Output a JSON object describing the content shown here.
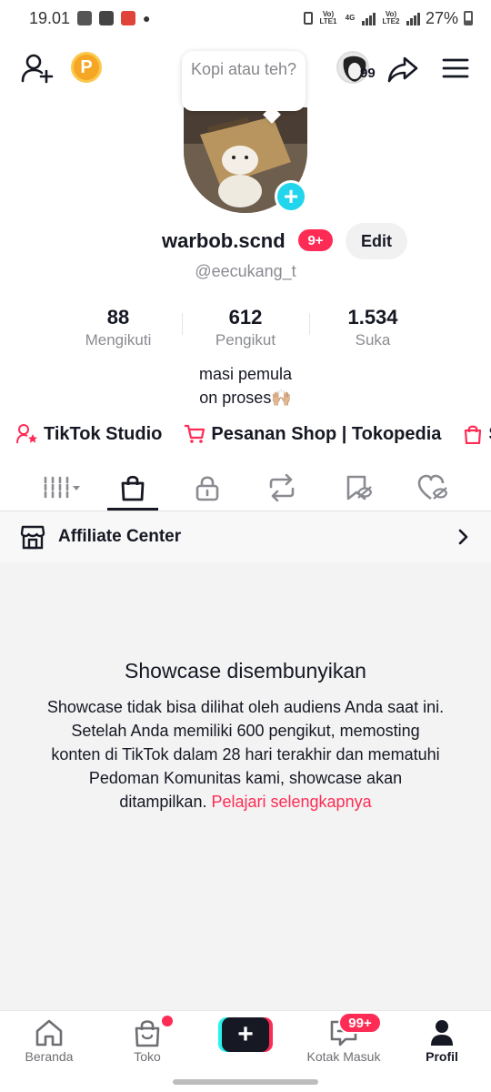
{
  "status_bar": {
    "time": "19.01",
    "network_1": "Vo) LTE1",
    "network_2": "4G",
    "network_3": "Vo) LTE2",
    "battery": "27%"
  },
  "top_nav": {
    "coin_letter": "P",
    "story_count": "99",
    "tooltip": "Kopi atau teh?"
  },
  "profile": {
    "display_name": "warbob.scnd",
    "notification_badge": "9+",
    "edit_label": "Edit",
    "username": "@eecukang_t",
    "stats": [
      {
        "value": "88",
        "label": "Mengikuti"
      },
      {
        "value": "612",
        "label": "Pengikut"
      },
      {
        "value": "1.534",
        "label": "Suka"
      }
    ],
    "bio_line_1": "masi pemula",
    "bio_line_2": "on proses🙌🏼"
  },
  "shortcuts": [
    {
      "label": "TikTok Studio"
    },
    {
      "label": "Pesanan Shop | Tokopedia"
    },
    {
      "label": "Sl"
    }
  ],
  "affiliate": {
    "label": "Affiliate Center"
  },
  "showcase": {
    "title": "Showcase disembunyikan",
    "description": "Showcase tidak bisa dilihat oleh audiens Anda saat ini. Setelah Anda memiliki 600 pengikut, memosting konten di TikTok dalam 28 hari terakhir dan mematuhi Pedoman Komunitas kami, showcase akan ditampilkan.",
    "link": "Pelajari selengkapnya"
  },
  "bottom_nav": {
    "items": [
      {
        "label": "Beranda"
      },
      {
        "label": "Toko"
      },
      {
        "label": "Kotak Masuk"
      },
      {
        "label": "Profil"
      }
    ],
    "inbox_badge": "99+"
  },
  "colors": {
    "accent": "#fe2c55",
    "cyan": "#25f4ee",
    "text": "#161823",
    "muted": "#8a8b91"
  }
}
